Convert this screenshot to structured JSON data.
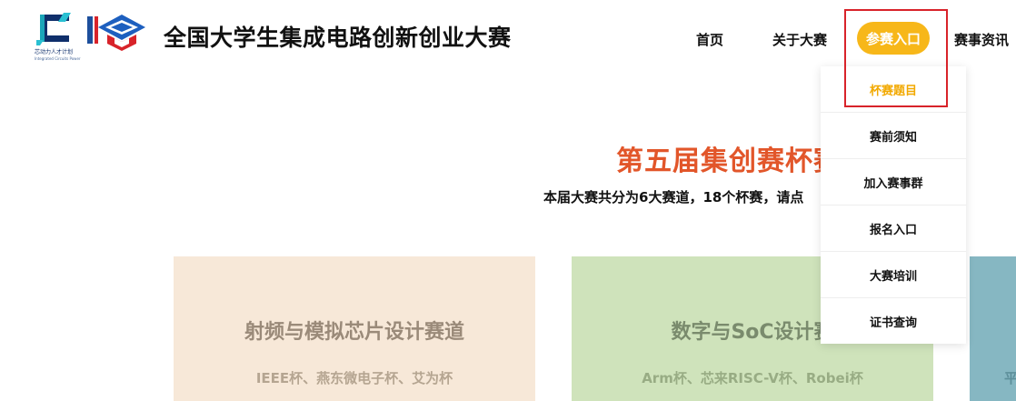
{
  "header": {
    "logo_left_text": "芯动力人才计划",
    "logo_left_subtext": "Integrated Circuits Power",
    "site_title": "全国大学生集成电路创新创业大赛"
  },
  "nav": {
    "home": "首页",
    "about": "关于大赛",
    "entry": "参赛入口",
    "news": "赛事资讯"
  },
  "dropdown": {
    "items": [
      {
        "label": "杯赛题目",
        "active": true
      },
      {
        "label": "赛前须知"
      },
      {
        "label": "加入赛事群"
      },
      {
        "label": "报名入口"
      },
      {
        "label": "大赛培训"
      },
      {
        "label": "证书查询"
      }
    ]
  },
  "main": {
    "title": "第五届集创赛杯赛",
    "description": "本届大赛共分为6大赛道，18个杯赛，请点"
  },
  "cards": [
    {
      "title": "射频与模拟芯片设计赛道",
      "subtitle": "IEEE杯、燕东微电子杯、艾为杯"
    },
    {
      "title": "数字与SoC设计赛",
      "subtitle": "Arm杯、芯来RISC-V杯、Robei杯"
    },
    {
      "title": "",
      "subtitle": "平"
    }
  ],
  "colors": {
    "accent": "#f7b719",
    "active_item": "#f2a900",
    "title_orange": "#e2562a",
    "highlight_border": "#d8232a",
    "card_rf": "#f7e8d8",
    "card_soc": "#cfe3bb",
    "card_third": "#86b7c2"
  }
}
